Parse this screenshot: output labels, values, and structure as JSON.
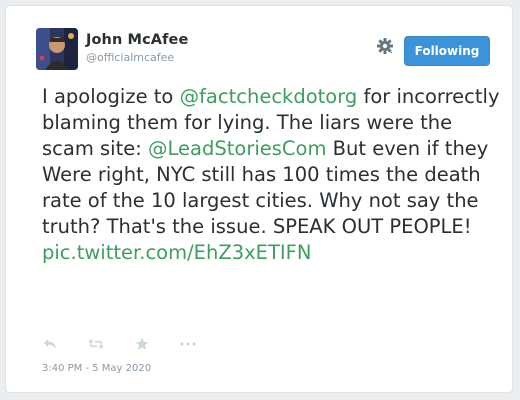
{
  "author": {
    "name": "John McAfee",
    "handle": "@officialmcafee"
  },
  "follow_button": {
    "label": "Following"
  },
  "tweet": {
    "segments": [
      {
        "text": "I apologize to ",
        "link": false
      },
      {
        "text": "@factcheckdotorg",
        "link": true
      },
      {
        "text": " for incorrectly blaming them for lying. The liars were the scam site: ",
        "link": false
      },
      {
        "text": "@LeadStoriesCom",
        "link": true
      },
      {
        "text": " But even if they Were right, NYC still has 100 times the death rate of the 10 largest cities. Why not say the truth? That's the issue. SPEAK OUT PEOPLE! ",
        "link": false
      },
      {
        "text": "pic.twitter.com/EhZ3xETIFN",
        "link": true
      }
    ]
  },
  "actions": [
    {
      "icon": "reply-icon"
    },
    {
      "icon": "retweet-icon"
    },
    {
      "icon": "like-star-icon"
    },
    {
      "icon": "more-icon"
    }
  ],
  "timestamp": "3:40 PM - 5 May 2020",
  "colors": {
    "link": "#3c9e5f",
    "follow_button": "#3b94d9",
    "text": "#292f33",
    "muted": "#8899a6",
    "icon": "#ccd6dd"
  }
}
